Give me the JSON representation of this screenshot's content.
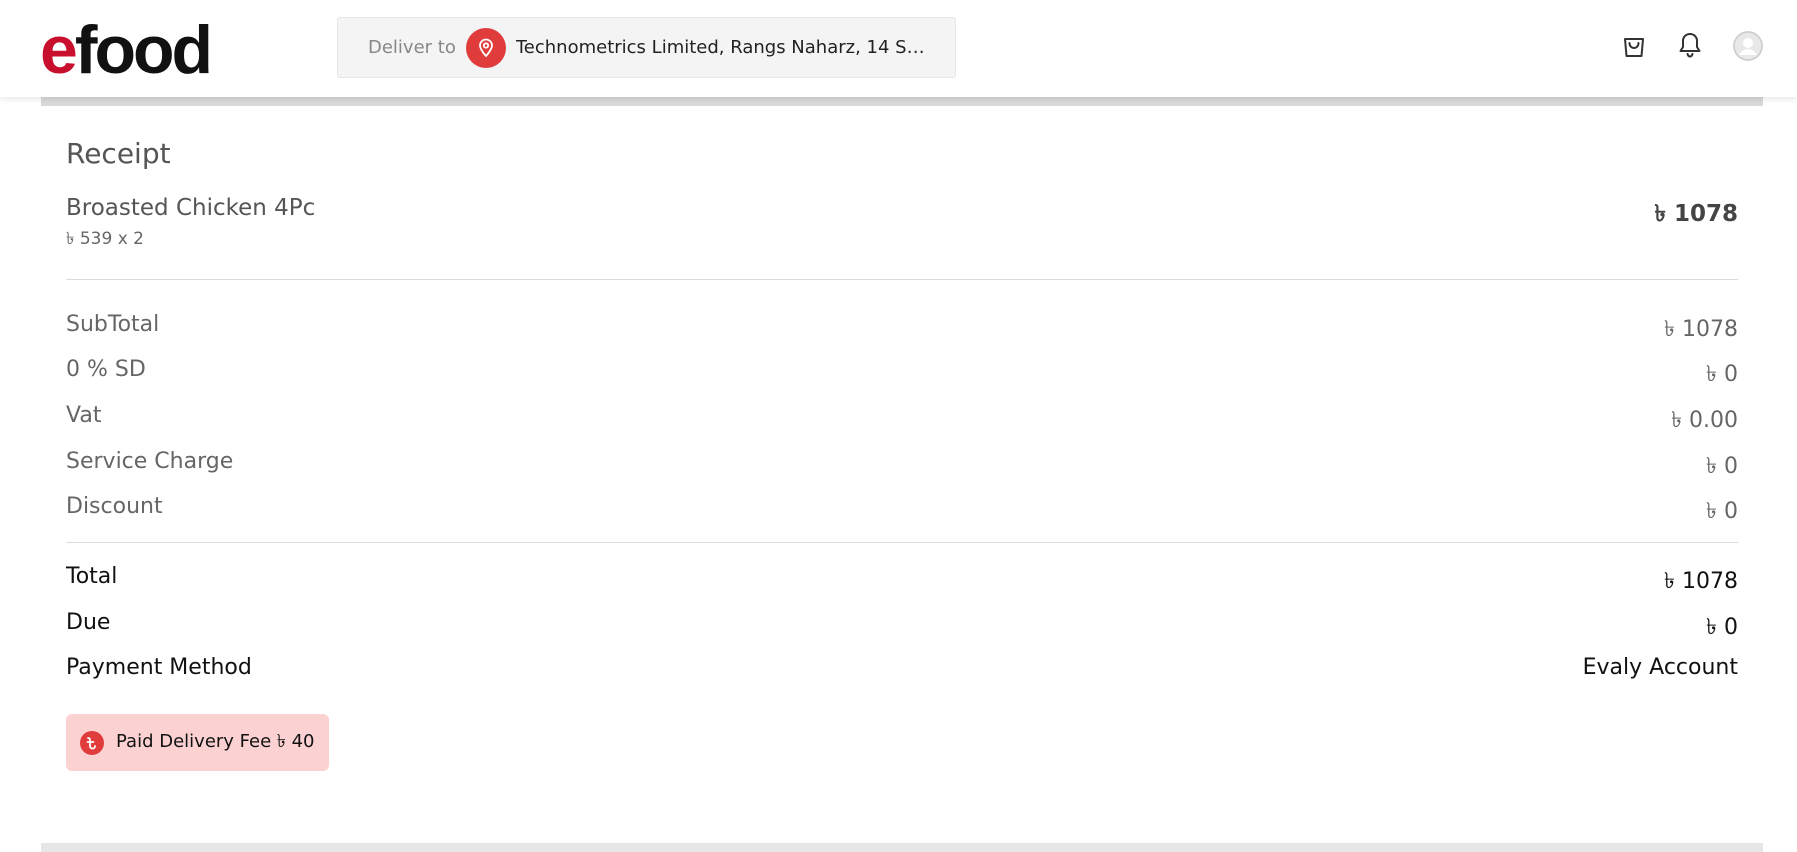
{
  "header": {
    "logo_e": "e",
    "logo_rest": "food",
    "deliver_label": "Deliver to",
    "address": "Technometrics Limited, Rangs Naharz, 14 Shah Ja..."
  },
  "receipt": {
    "title": "Receipt",
    "item": {
      "name": "Broasted Chicken 4Pc",
      "qty": "৳ 539 x 2",
      "total": "৳ 1078"
    },
    "subtotal": {
      "label": "SubTotal",
      "value": "৳ 1078"
    },
    "sd": {
      "label": "0 % SD",
      "value": "৳ 0"
    },
    "vat": {
      "label": "Vat",
      "value": "৳ 0.00"
    },
    "service": {
      "label": "Service Charge",
      "value": "৳ 0"
    },
    "discount": {
      "label": "Discount",
      "value": "৳ 0"
    },
    "total": {
      "label": "Total",
      "value": "৳ 1078"
    },
    "due": {
      "label": "Due",
      "value": "৳ 0"
    },
    "payment": {
      "label": "Payment Method",
      "value": "Evaly Account"
    },
    "fee_badge": "Paid Delivery Fee ৳ 40"
  },
  "colors": {
    "brand_red": "#c8102e",
    "pin_red": "#e03c3c",
    "badge_bg": "#fcd1d1"
  }
}
